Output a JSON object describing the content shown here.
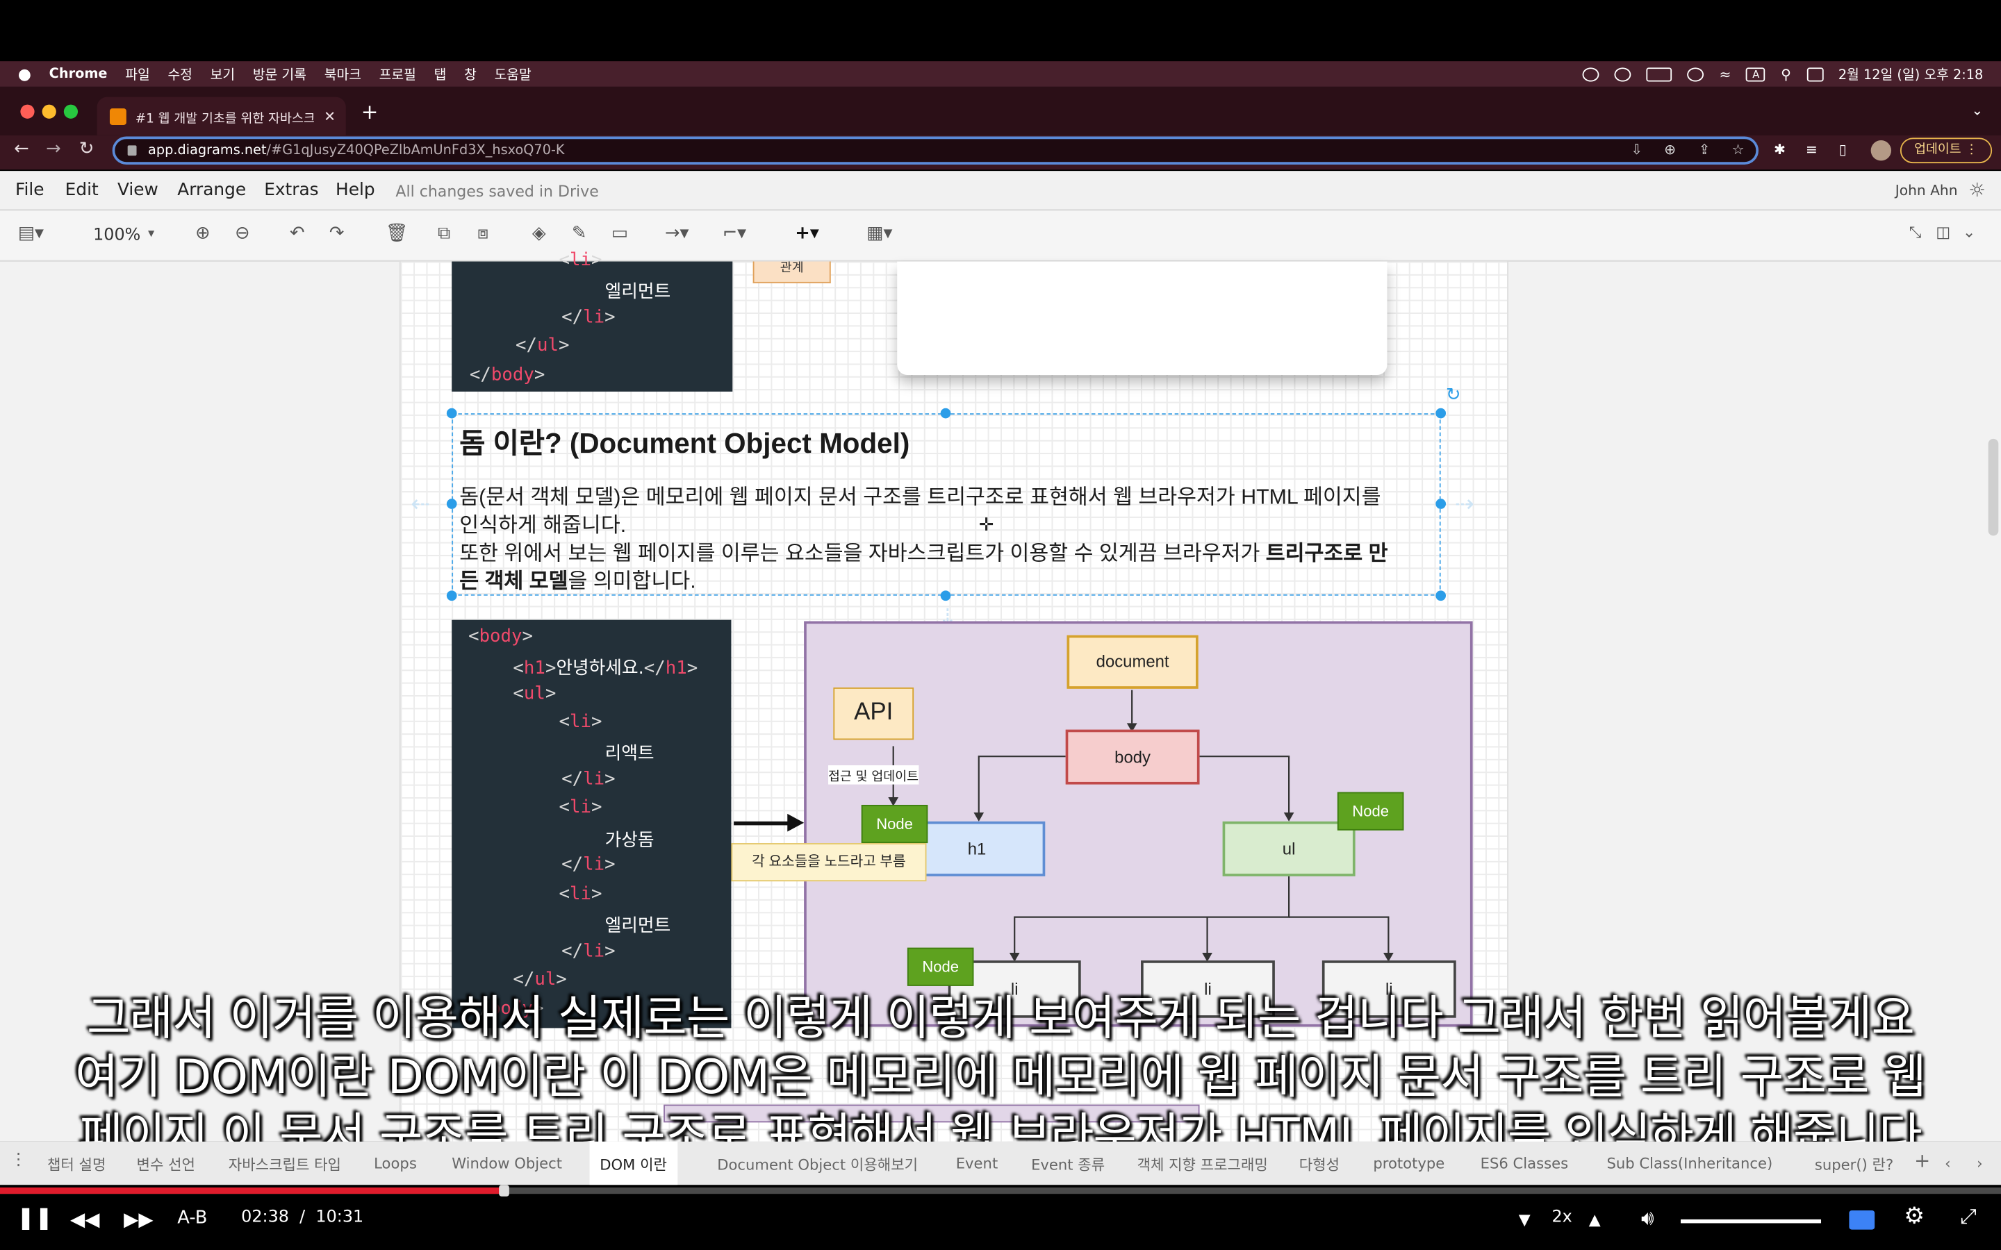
{
  "menubar": {
    "app": "Chrome",
    "items": [
      "파일",
      "수정",
      "보기",
      "방문 기록",
      "북마크",
      "프로필",
      "탭",
      "창",
      "도움말"
    ],
    "datetime": "2월 12일 (일) 오후 2:18",
    "input_source": "A"
  },
  "browser": {
    "tab_title": "#1 웹 개발 기초를 위한 자바스크립트",
    "url_host": "app.diagrams.net",
    "url_path": "/#G1qJusyZ40QPeZlbAmUnFd3X_hsxoQ70-K",
    "update_label": "업데이트"
  },
  "drawio": {
    "menu": [
      "File",
      "Edit",
      "View",
      "Arrange",
      "Extras",
      "Help"
    ],
    "save_status": "All changes saved in Drive",
    "user": "John Ahn",
    "zoom": "100%"
  },
  "canvas": {
    "top_code": {
      "lines": [
        {
          "open": "<",
          "tag": "li",
          "close": ">"
        },
        {
          "text": "엘리먼트"
        },
        {
          "open": "</",
          "tag": "li",
          "close": ">"
        },
        {
          "open": "</",
          "tag": "ul",
          "close": ">"
        },
        {
          "open": "</",
          "tag": "body",
          "close": ">"
        }
      ]
    },
    "top_orange_label": "관계",
    "dom_title": "돔 이란? (Document Object Model)",
    "para1_line1": "돔(문서 객체 모델)은 메모리에 웹 페이지 문서 구조를 트리구조로 표현해서 웹 브라우저가 HTML 페이지를",
    "para1_line2": "인식하게 해줍니다.",
    "para2_line1_a": "또한 위에서 보는 웹 페이지를 이루는 요소들을 자바스크립트가 이용할 수 있게끔 브라우저가 ",
    "para2_line1_b": "트리구조로 만",
    "para2_line2_a": "든 객체 모델",
    "para2_line2_b": "을 의미합니다.",
    "code": {
      "lines": [
        {
          "open": "<",
          "tag": "body",
          "close": ">"
        },
        {
          "open": "<",
          "tag": "h1",
          "close": ">",
          "inner": "안녕하세요.",
          "open2": "</",
          "tag2": "h1",
          "close2": ">"
        },
        {
          "open": "<",
          "tag": "ul",
          "close": ">"
        },
        {
          "open": "<",
          "tag": "li",
          "close": ">"
        },
        {
          "text": "리액트"
        },
        {
          "open": "</",
          "tag": "li",
          "close": ">"
        },
        {
          "open": "<",
          "tag": "li",
          "close": ">"
        },
        {
          "text": "가상돔"
        },
        {
          "open": "</",
          "tag": "li",
          "close": ">"
        },
        {
          "open": "<",
          "tag": "li",
          "close": ">"
        },
        {
          "text": "엘리먼트"
        },
        {
          "open": "</",
          "tag": "li",
          "close": ">"
        },
        {
          "open": "</",
          "tag": "ul",
          "close": ">"
        },
        {
          "open": "</",
          "tag": "body",
          "close": ">"
        }
      ]
    },
    "diagram": {
      "document": "document",
      "body": "body",
      "h1": "h1",
      "ul": "ul",
      "li": "li",
      "api": "API",
      "api_note": "접근 및 업데이트",
      "node": "Node",
      "node_note": "각 요소들을 노드라고 부름"
    }
  },
  "subtitles": [
    "그래서 이거를 이용해서 실제로는 이렇게 이렇게 보여주게 되는 겁니다 그래서 한번 읽어볼게요",
    "여기 DOM이란 DOM이란 이 DOM은 메모리에 메모리에 웹 페이지 문서 구조를 트리 구조로 웹",
    "페이지 이 문서 구조를 트리 구조로 표현해서 웹 브라우저가 HTML 페이지를 인식하게 해줍니다"
  ],
  "page_tabs": [
    "챕터 설명",
    "변수 선언",
    "자바스크립트 타입",
    "Loops",
    "Window Object",
    "DOM 이란",
    "Document Object 이용해보기",
    "Event",
    "Event 종류",
    "객체 지향 프로그래밍",
    "다형성",
    "prototype",
    "ES6 Classes",
    "Sub Class(Inheritance)",
    "super() 란?"
  ],
  "active_page_tab": "DOM 이란",
  "player": {
    "ab_label": "A-B",
    "current_time": "02:38",
    "separator": "/",
    "duration": "10:31",
    "speed": "2x",
    "progress": 0.2504,
    "volume": 1.0
  },
  "colors": {
    "menubar": "#48202c",
    "code_bg": "#233039",
    "tag_red": "#f04a6b",
    "diagram_bg": "#e2d6e8",
    "node_green": "#5ea21f",
    "progress_red": "#e01c2c"
  },
  "icons": [
    "apple-icon",
    "back-icon",
    "forward-icon",
    "reload-icon",
    "lock-icon",
    "star-icon",
    "extensions-icon",
    "play-pause-icon",
    "rewind-icon",
    "fast-forward-icon",
    "volume-icon",
    "subtitles-icon",
    "settings-icon",
    "fullscreen-icon"
  ]
}
